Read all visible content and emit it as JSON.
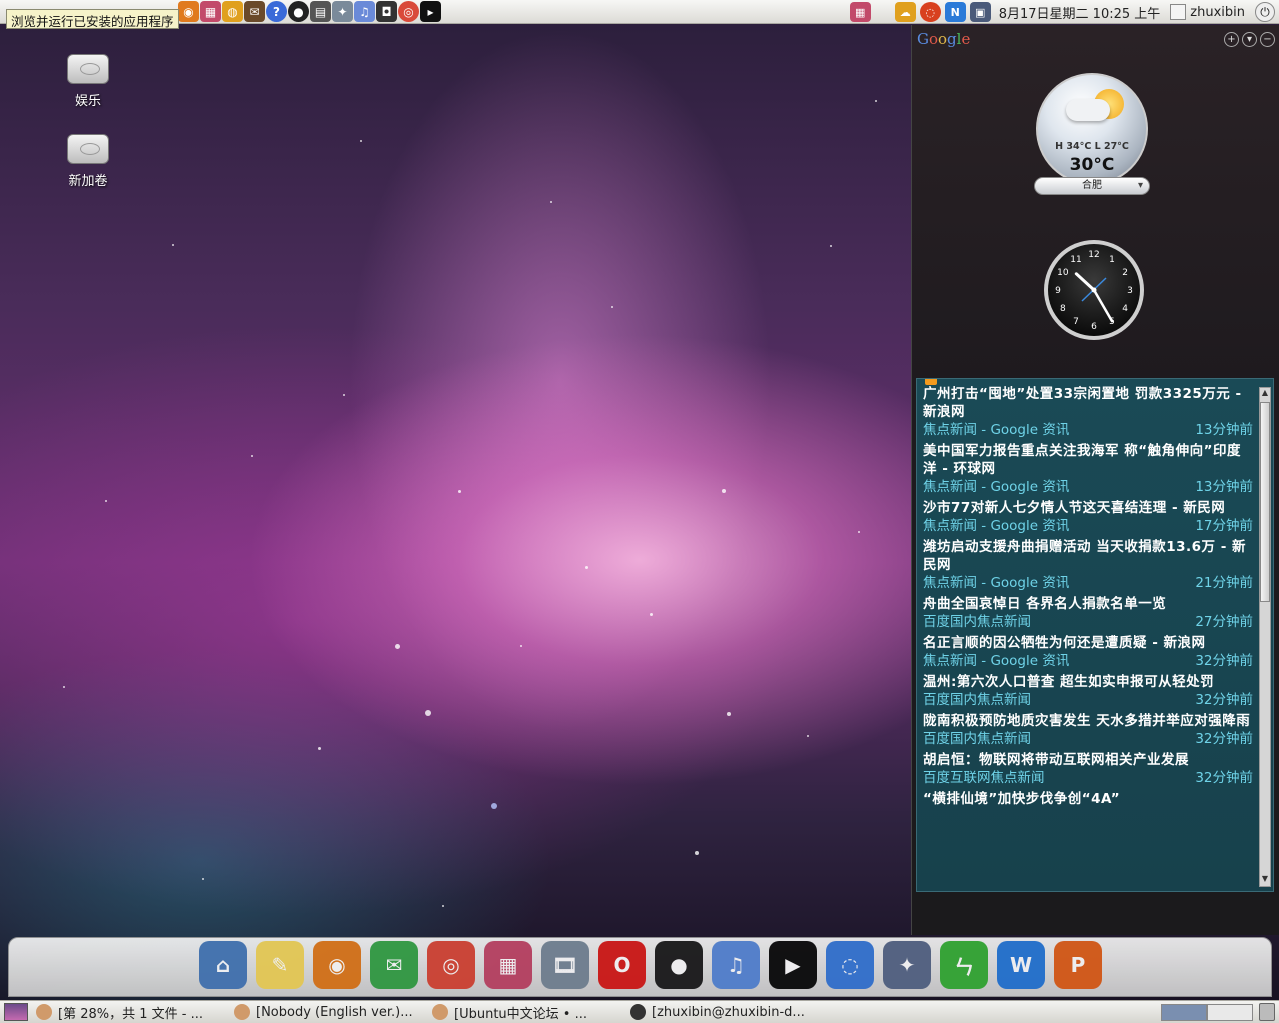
{
  "top_panel": {
    "tooltip": "浏览并运行已安装的应用程序",
    "datetime": "8月17日星期二 10:25 上午",
    "username": "zhuxibin"
  },
  "desktop": {
    "icons": [
      {
        "label": "娱乐"
      },
      {
        "label": "新加卷"
      }
    ]
  },
  "sidebar": {
    "logo_letters": [
      "G",
      "o",
      "o",
      "g",
      "l",
      "e"
    ],
    "weather": {
      "high_low": "H 34°C L 27°C",
      "temp": "30°C",
      "city": "合肥"
    },
    "clock": {
      "numbers": [
        "12",
        "1",
        "2",
        "3",
        "4",
        "5",
        "6",
        "7",
        "8",
        "9",
        "10",
        "11"
      ],
      "hour": 10,
      "minute": 25
    },
    "news": [
      {
        "title": "广州打击“囤地”处置33宗闲置地 罚款3325万元 - 新浪网",
        "source": "焦点新闻 - Google 资讯",
        "time": "13分钟前"
      },
      {
        "title": "美中国军力报告重点关注我海军 称“触角伸向”印度洋 - 环球网",
        "source": "焦点新闻 - Google 资讯",
        "time": "13分钟前"
      },
      {
        "title": "沙市77对新人七夕情人节这天喜结连理 - 新民网",
        "source": "焦点新闻 - Google 资讯",
        "time": "17分钟前"
      },
      {
        "title": "潍坊启动支援舟曲捐赠活动 当天收捐款13.6万 - 新民网",
        "source": "焦点新闻 - Google 资讯",
        "time": "21分钟前"
      },
      {
        "title": "舟曲全国哀悼日 各界名人捐款名单一览",
        "source": "百度国内焦点新闻",
        "time": "27分钟前"
      },
      {
        "title": "名正言顺的因公牺牲为何还是遭质疑 - 新浪网",
        "source": "焦点新闻 - Google 资讯",
        "time": "32分钟前"
      },
      {
        "title": "温州:第六次人口普查 超生如实申报可从轻处罚",
        "source": "百度国内焦点新闻",
        "time": "32分钟前"
      },
      {
        "title": "陇南积极预防地质灾害发生 天水多措并举应对强降雨",
        "source": "百度国内焦点新闻",
        "time": "32分钟前"
      },
      {
        "title": "胡启恒：物联网将带动互联网相关产业发展",
        "source": "百度互联网焦点新闻",
        "time": "32分钟前"
      },
      {
        "title": "“横排仙境”加快步伐争创“4A”",
        "source": "",
        "time": ""
      }
    ]
  },
  "dock": {
    "icons": [
      {
        "name": "home-folder-icon",
        "color": "#4a7ab8",
        "glyph": "⌂"
      },
      {
        "name": "sticky-notes-icon",
        "color": "#f2d45c",
        "glyph": "✎"
      },
      {
        "name": "browser-icon",
        "color": "#e07a1e",
        "glyph": "◉"
      },
      {
        "name": "mail-icon",
        "color": "#3aa44a",
        "glyph": "✉"
      },
      {
        "name": "chrome-icon",
        "color": "#d94a3a",
        "glyph": "◎"
      },
      {
        "name": "app-launcher-icon",
        "color": "#c24a6a",
        "glyph": "▦"
      },
      {
        "name": "video-editor-icon",
        "color": "#7a8a9a",
        "glyph": "🎞"
      },
      {
        "name": "opera-icon",
        "color": "#d8201e",
        "glyph": "O"
      },
      {
        "name": "qq-icon",
        "color": "#222222",
        "glyph": "●"
      },
      {
        "name": "itunes-icon",
        "color": "#5a8ad8",
        "glyph": "♫"
      },
      {
        "name": "terminal-icon",
        "color": "#111111",
        "glyph": "▶"
      },
      {
        "name": "chat-icon",
        "color": "#3a7ad8",
        "glyph": "◌"
      },
      {
        "name": "mail-stamp-icon",
        "color": "#5a6a8a",
        "glyph": "✦"
      },
      {
        "name": "spreadsheet-icon",
        "color": "#3ab03a",
        "glyph": "ㄣ"
      },
      {
        "name": "word-icon",
        "color": "#2a7ad8",
        "glyph": "W"
      },
      {
        "name": "presentation-icon",
        "color": "#e0621e",
        "glyph": "P"
      }
    ]
  },
  "taskbar": {
    "tasks": [
      {
        "label": "[第 28%，共 1 文件 - ...",
        "color": "#d09a6a"
      },
      {
        "label": "[Nobody (English ver.)...",
        "color": "#d09a6a"
      },
      {
        "label": "[Ubuntu中文论坛 • ...",
        "color": "#d09a6a"
      },
      {
        "label": "[zhuxibin@zhuxibin-d...",
        "color": "#333333"
      }
    ]
  },
  "colors": {
    "news_meta": "#6fd3e8",
    "news_bg": "#1a4a56"
  }
}
